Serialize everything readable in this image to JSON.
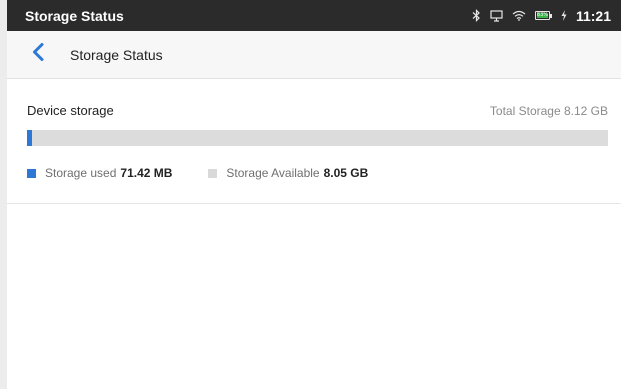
{
  "status_bar": {
    "title": "Storage Status",
    "time": "11:21",
    "battery_level": "83%",
    "icons": [
      "bluetooth-icon",
      "screen-cast-icon",
      "wifi-icon",
      "battery-icon",
      "charging-icon"
    ]
  },
  "header": {
    "back_icon": "chevron-left-icon",
    "title": "Storage Status"
  },
  "storage": {
    "label": "Device storage",
    "total_text": "Total Storage 8.12 GB",
    "used_fraction": 0.0087,
    "used_label": "Storage used",
    "used_value": "71.42 MB",
    "available_label": "Storage Available",
    "available_value": "8.05 GB"
  },
  "colors": {
    "accent": "#2d78d6",
    "status_bar": "#2b2b2b",
    "bar_track": "#dcdcdc",
    "battery": "#3cb64a"
  }
}
